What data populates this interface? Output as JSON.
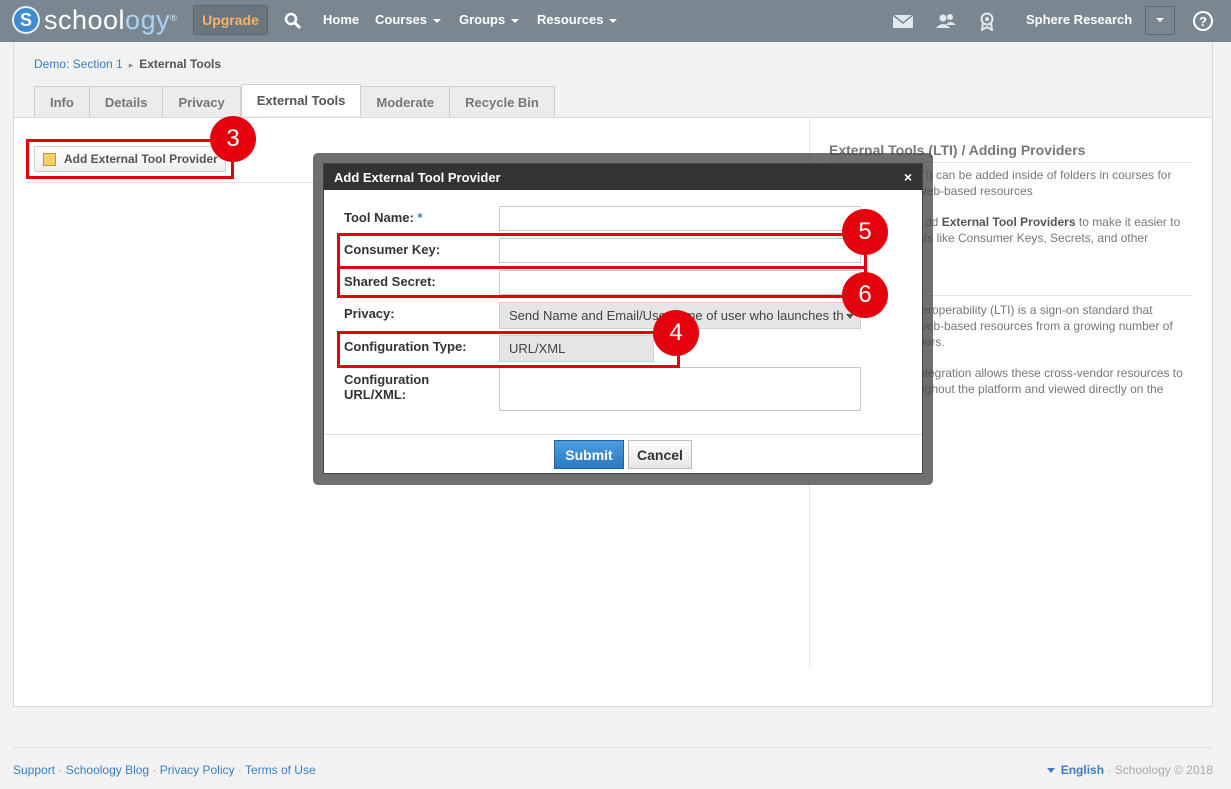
{
  "brand": {
    "logo_letter": "S",
    "logo_text_a": "school",
    "logo_text_b": "ogy",
    "logo_text_mid": "l",
    "reg_mark": "®"
  },
  "nav": {
    "upgrade": "Upgrade",
    "items": [
      "Home",
      "Courses",
      "Groups",
      "Resources"
    ],
    "user_name": "Sphere Research",
    "help": "?"
  },
  "breadcrumb": {
    "parent": "Demo: Section 1",
    "arrow": "▸",
    "current": "External Tools"
  },
  "tabs": [
    "Info",
    "Details",
    "Privacy",
    "External Tools",
    "Moderate",
    "Recycle Bin"
  ],
  "active_tab": "External Tools",
  "actions": {
    "add_provider": "Add External Tool Provider"
  },
  "sidebar": {
    "heading": "External Tools (LTI) / Adding Providers",
    "p1": "TI) can be added inside of folders in courses for",
    "p1b": "web-based resources",
    "p2_pre": "dd",
    "p2_bold": "External Tool Providers",
    "p2_post": "to make it easier to",
    "p2b": "als like Consumer Keys, Secrets, and other",
    "p3": "teroperability (LTI) is a sign-on standard that",
    "p3b": "web-based resources from a growing number of",
    "p3c": "dors.",
    "p4": "ntegration allows these cross-vendor resources to",
    "p4b": "ughout the platform and viewed directly on the"
  },
  "modal": {
    "title": "Add External Tool Provider",
    "close": "×",
    "tool_name_label": "Tool Name:",
    "required_mark": "*",
    "tool_name_value": "",
    "consumer_key_label": "Consumer Key:",
    "consumer_key_value": "",
    "shared_secret_label": "Shared Secret:",
    "shared_secret_value": "",
    "privacy_label": "Privacy:",
    "privacy_value": "Send Name and Email/Username of user who launches th",
    "config_type_label": "Configuration Type:",
    "config_type_value": "URL/XML",
    "config_url_label_1": "Configuration",
    "config_url_label_2": "URL/XML:",
    "config_url_value": "",
    "submit": "Submit",
    "cancel": "Cancel"
  },
  "annotations": [
    "3",
    "4",
    "5",
    "6"
  ],
  "annotation_color": "#e5000d",
  "footer": {
    "links": [
      "Support",
      "Schoology Blog",
      "Privacy Policy",
      "Terms of Use"
    ],
    "separator": "·",
    "language": "English",
    "copyright": "Schoology © 2018"
  },
  "colors": {
    "topbar": "#7a8791",
    "link": "#3b7ec0",
    "submit": "#2b79c2",
    "upgrade_text": "#f7b267"
  }
}
